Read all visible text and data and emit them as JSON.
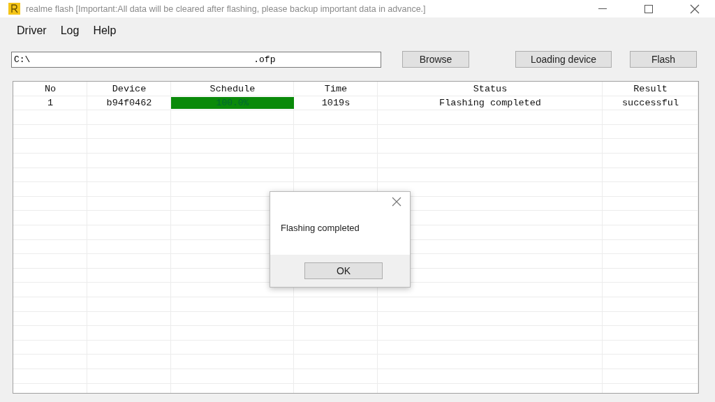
{
  "window": {
    "title": "realme flash [Important:All data will be cleared after flashing, please backup important data in advance.]"
  },
  "menu": [
    "Driver",
    "Log",
    "Help"
  ],
  "path_field": {
    "value": "C:\\                                         .ofp"
  },
  "buttons": [
    "Browse",
    "Loading device",
    "Flash"
  ],
  "table": {
    "columns": [
      "No",
      "Device",
      "Schedule",
      "Time",
      "Status",
      "Result"
    ],
    "rows": [
      {
        "no": "1",
        "device": "b94f0462",
        "schedule": {
          "reading": "100.0%"
        },
        "time": "1019s",
        "status": "Flashing completed",
        "result": "successful"
      }
    ]
  },
  "dialog": {
    "message": "Flashing completed",
    "button": "OK"
  }
}
